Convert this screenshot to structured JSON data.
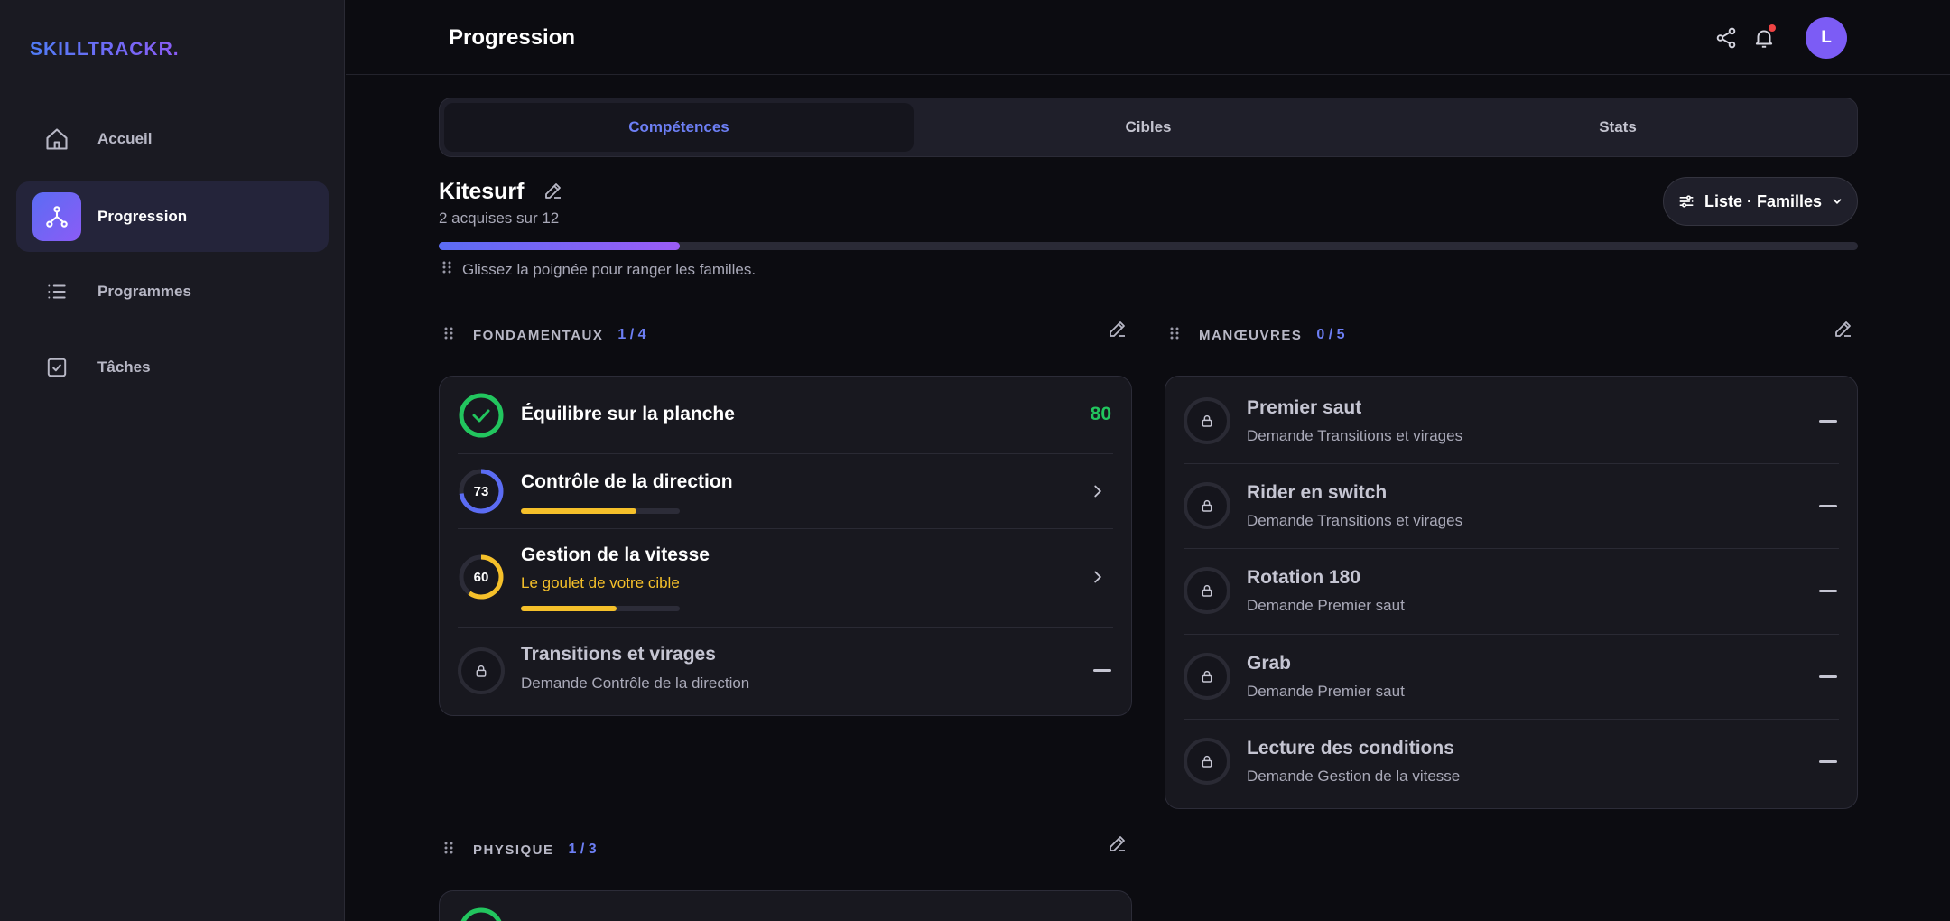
{
  "app": {
    "logo": "SKILLTRACKR."
  },
  "sidebar": {
    "items": [
      {
        "label": "Accueil",
        "icon": "home-icon",
        "active": false
      },
      {
        "label": "Progression",
        "icon": "tree-icon",
        "active": true
      },
      {
        "label": "Programmes",
        "icon": "list-icon",
        "active": false
      },
      {
        "label": "Tâches",
        "icon": "checkbox-icon",
        "active": false
      }
    ]
  },
  "header": {
    "title": "Progression",
    "avatar_initial": "L"
  },
  "tabs": [
    {
      "label": "Compétences",
      "active": true
    },
    {
      "label": "Cibles",
      "active": false
    },
    {
      "label": "Stats",
      "active": false
    }
  ],
  "sport": {
    "title": "Kitesurf",
    "subtitle": "2 acquises sur 12",
    "progress_fraction": 0.17,
    "view_label": "Liste · Familles",
    "hint": "Glissez la poignée pour ranger les familles."
  },
  "families": {
    "fondamentaux": {
      "name": "FONDAMENTAUX",
      "count": "1 / 4",
      "skills": [
        {
          "name": "Équilibre sur la planche",
          "score": "80",
          "state": "done"
        },
        {
          "name": "Contrôle de la direction",
          "level": "73",
          "bar": 0.73,
          "state": "progress"
        },
        {
          "name": "Gestion de la vitesse",
          "level": "60",
          "bar": 0.6,
          "sub": "Le goulet de votre cible",
          "state": "progress"
        },
        {
          "name": "Transitions et virages",
          "sub": "Demande Contrôle de la direction",
          "state": "locked"
        }
      ]
    },
    "manoeuvres": {
      "name": "MANŒUVRES",
      "count": "0 / 5",
      "skills": [
        {
          "name": "Premier saut",
          "sub": "Demande Transitions et virages"
        },
        {
          "name": "Rider en switch",
          "sub": "Demande Transitions et virages"
        },
        {
          "name": "Rotation 180",
          "sub": "Demande Premier saut"
        },
        {
          "name": "Grab",
          "sub": "Demande Premier saut"
        },
        {
          "name": "Lecture des conditions",
          "sub": "Demande Gestion de la vitesse"
        }
      ]
    },
    "physique": {
      "name": "PHYSIQUE",
      "count": "1 / 3"
    }
  },
  "colors": {
    "accent": "#6d7ff5",
    "success": "#22c55e",
    "warning": "#f5c02a",
    "notification": "#ef4444"
  }
}
